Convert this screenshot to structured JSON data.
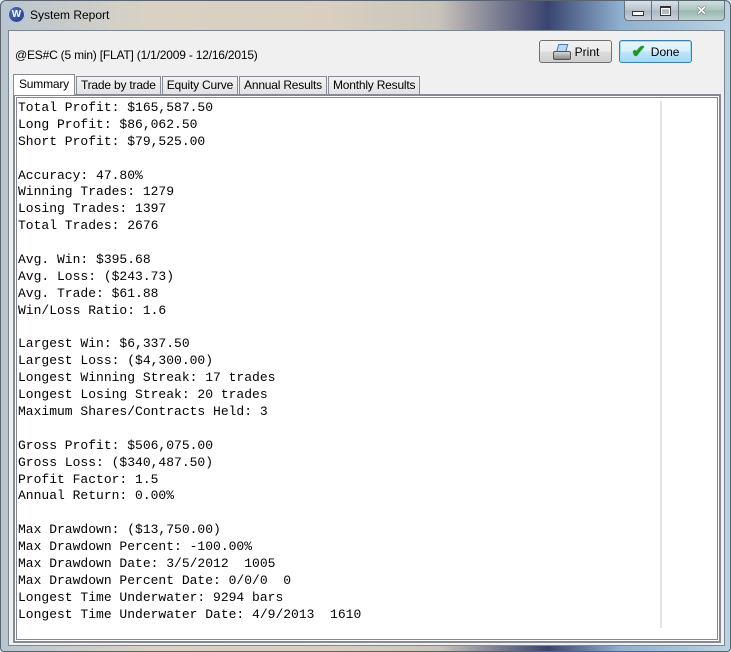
{
  "window": {
    "title": "System Report",
    "app_icon": "wealth-lab-logo-icon",
    "caption_buttons": [
      "minimize",
      "maximize",
      "close"
    ]
  },
  "header": {
    "subtitle": "@ES#C (5 min) [FLAT]  (1/1/2009 - 12/16/2015)",
    "print_label": "Print",
    "done_label": "Done"
  },
  "tabs": [
    {
      "label": "Summary",
      "active": true
    },
    {
      "label": "Trade by trade",
      "active": false
    },
    {
      "label": "Equity Curve",
      "active": false
    },
    {
      "label": "Annual Results",
      "active": false
    },
    {
      "label": "Monthly Results",
      "active": false
    }
  ],
  "report_lines": [
    "Total Profit: $165,587.50",
    "Long Profit: $86,062.50",
    "Short Profit: $79,525.00",
    "",
    "Accuracy: 47.80%",
    "Winning Trades: 1279",
    "Losing Trades: 1397",
    "Total Trades: 2676",
    "",
    "Avg. Win: $395.68",
    "Avg. Loss: ($243.73)",
    "Avg. Trade: $61.88",
    "Win/Loss Ratio: 1.6",
    "",
    "Largest Win: $6,337.50",
    "Largest Loss: ($4,300.00)",
    "Longest Winning Streak: 17 trades",
    "Longest Losing Streak: 20 trades",
    "Maximum Shares/Contracts Held: 3",
    "",
    "Gross Profit: $506,075.00",
    "Gross Loss: ($340,487.50)",
    "Profit Factor: 1.5",
    "Annual Return: 0.00%",
    "",
    "Max Drawdown: ($13,750.00)",
    "Max Drawdown Percent: -100.00%",
    "Max Drawdown Date: 3/5/2012  1005",
    "Max Drawdown Percent Date: 0/0/0  0",
    "Longest Time Underwater: 9294 bars",
    "Longest Time Underwater Date: 4/9/2013  1610"
  ]
}
